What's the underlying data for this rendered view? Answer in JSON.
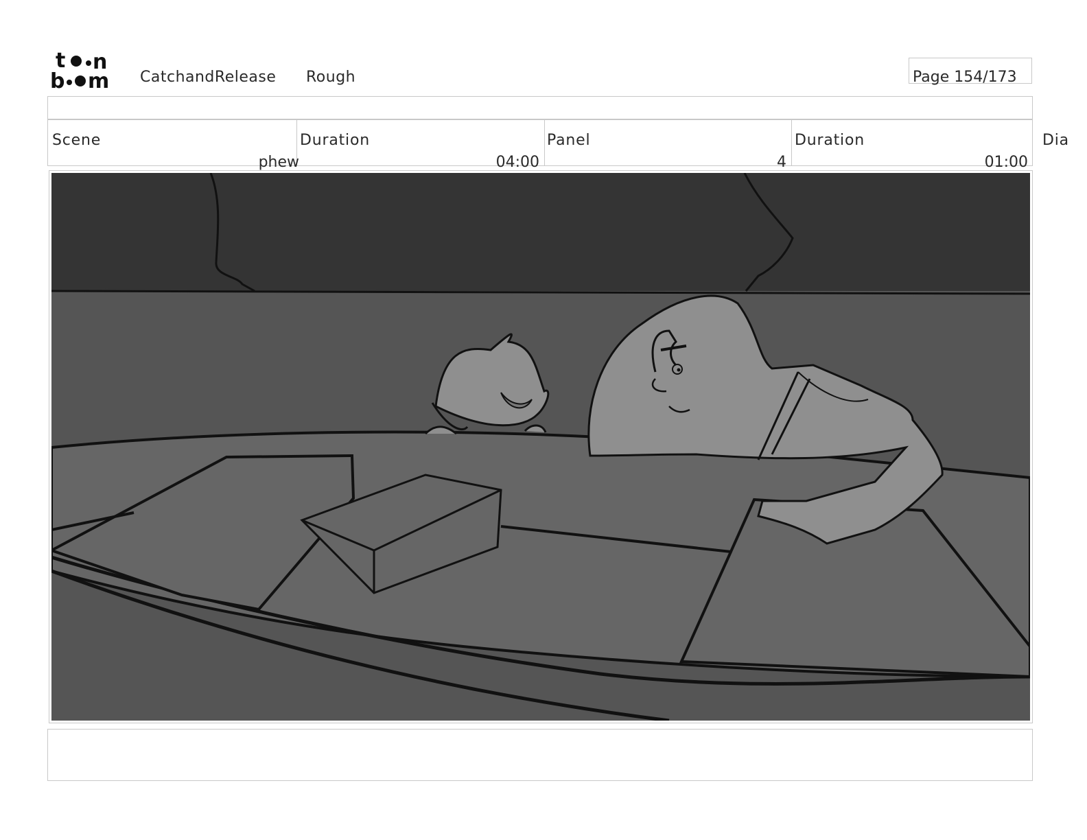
{
  "header": {
    "logo_text": "toon boom",
    "project": "CatchandRelease",
    "stage": "Rough",
    "page": "Page 154/173"
  },
  "fields": {
    "scene_label": "Scene",
    "scene_value": "phew",
    "scene_duration_label": "Duration",
    "scene_duration_value": "04:00",
    "panel_label": "Panel",
    "panel_value": "4",
    "panel_duration_label": "Duration",
    "panel_duration_value": "01:00",
    "dialogue_label": "Dia"
  },
  "panel_image": {
    "description_icon": "storyboard-sketch",
    "colors": {
      "sky": "#343434",
      "water": "#555555",
      "boat": "#666666",
      "skin": "#8f8f8f",
      "line": "#111111"
    }
  },
  "notes": {
    "text": ""
  }
}
